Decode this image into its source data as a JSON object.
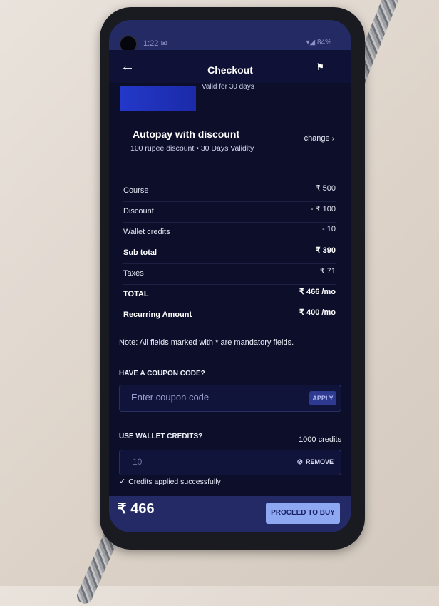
{
  "status": {
    "time": "1:22 ✉",
    "icons": "▾◢ 84%"
  },
  "header": {
    "back_icon": "←",
    "title": "Checkout",
    "flag_icon": "⚑"
  },
  "banner": {
    "valid_text": "Valid for 30 days"
  },
  "plan": {
    "title": "Autopay with discount",
    "subtitle": "100 rupee discount • 30 Days Validity",
    "change_label": "change",
    "change_icon": "›"
  },
  "pricing": [
    {
      "label": "Course",
      "value": "₹ 500",
      "bold": false
    },
    {
      "label": "Discount",
      "value": "- ₹ 100",
      "bold": false
    },
    {
      "label": "Wallet credits",
      "value": "- 10",
      "bold": false
    },
    {
      "label": "Sub total",
      "value": "₹ 390",
      "bold": true
    },
    {
      "label": "Taxes",
      "value": "₹ 71",
      "bold": false
    },
    {
      "label": "TOTAL",
      "value": "₹ 466 /mo",
      "bold": true
    },
    {
      "label": "Recurring Amount",
      "value": "₹ 400 /mo",
      "bold": true
    }
  ],
  "note": "Note: All fields marked with * are mandatory fields.",
  "coupon": {
    "label": "HAVE A COUPON CODE?",
    "placeholder": "Enter coupon code",
    "apply_label": "APPLY"
  },
  "wallet": {
    "label": "USE WALLET CREDITS?",
    "credits": "1000 credits",
    "value": "10",
    "remove_icon": "⊘",
    "remove_label": "REMOVE",
    "success_icon": "✓",
    "success_text": "Credits applied successfully"
  },
  "footer": {
    "total": "₹ 466",
    "proceed_label": "PROCEED TO BUY"
  }
}
